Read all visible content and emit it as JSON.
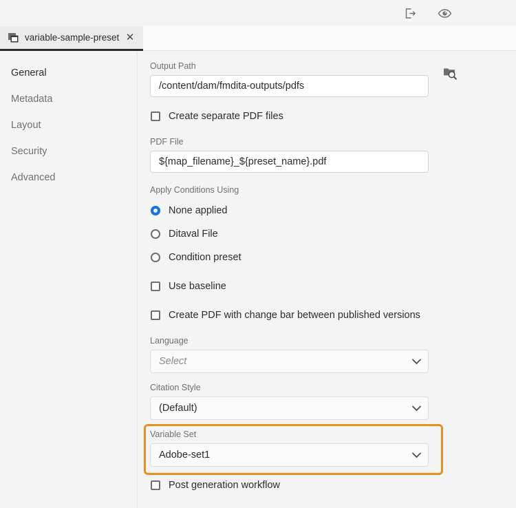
{
  "topbar": {
    "icons": [
      {
        "name": "export-icon",
        "title": "Export"
      },
      {
        "name": "preview-eye-icon",
        "title": "Preview"
      }
    ]
  },
  "tab": {
    "icon": "windows-stack-icon",
    "label": "variable-sample-preset",
    "close_label": "✕"
  },
  "sidebar": {
    "items": [
      {
        "label": "General",
        "active": true
      },
      {
        "label": "Metadata",
        "active": false
      },
      {
        "label": "Layout",
        "active": false
      },
      {
        "label": "Security",
        "active": false
      },
      {
        "label": "Advanced",
        "active": false
      }
    ]
  },
  "form": {
    "output_path": {
      "label": "Output Path",
      "value": "/content/dam/fmdita-outputs/pdfs",
      "placeholder": "",
      "browse_icon": "folder-search-icon"
    },
    "create_separate_pdf": {
      "label": "Create separate PDF files",
      "checked": false
    },
    "pdf_file": {
      "label": "PDF File",
      "value": "${map_filename}_${preset_name}.pdf",
      "placeholder": ""
    },
    "apply_conditions": {
      "label": "Apply Conditions Using",
      "options": [
        {
          "label": "None applied",
          "selected": true
        },
        {
          "label": "Ditaval File",
          "selected": false
        },
        {
          "label": "Condition preset",
          "selected": false
        }
      ]
    },
    "use_baseline": {
      "label": "Use baseline",
      "checked": false
    },
    "change_bar": {
      "label": "Create PDF with change bar between published versions",
      "checked": false
    },
    "language": {
      "label": "Language",
      "value": "",
      "placeholder": "Select",
      "chevron": "chevron-down-icon"
    },
    "citation_style": {
      "label": "Citation Style",
      "value": "(Default)",
      "chevron": "chevron-down-icon"
    },
    "variable_set": {
      "label": "Variable Set",
      "value": "Adobe-set1",
      "chevron": "chevron-down-icon",
      "highlighted": true
    },
    "post_generation_workflow": {
      "label": "Post generation workflow",
      "checked": false
    }
  },
  "colors": {
    "accent_blue": "#1473e6",
    "highlight_orange": "#e8901a",
    "text_primary": "#2c2c2c",
    "text_secondary": "#707070",
    "page_bg": "#f4f4f4"
  }
}
